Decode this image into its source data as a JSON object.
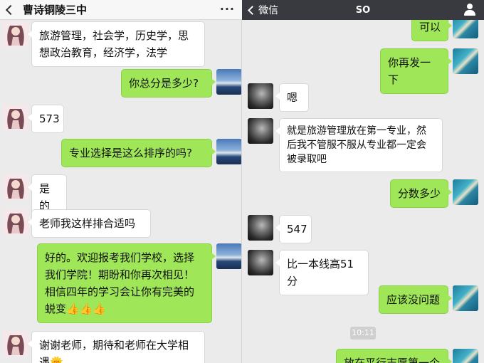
{
  "left_chat": {
    "title": "曹诗铜陵三中",
    "more_label": "···",
    "messages": [
      {
        "side": "in",
        "text": "旅游管理，社会学，历史学，思想政治教育，经济学，法学"
      },
      {
        "side": "out",
        "text": "你总分是多少?"
      },
      {
        "side": "in",
        "text": "573"
      },
      {
        "side": "out",
        "text": "专业选择是这么排序的吗?"
      },
      {
        "side": "in",
        "text": "是的"
      },
      {
        "side": "in",
        "text": "老师我这样排合适吗"
      },
      {
        "side": "out",
        "text": "好的。欢迎报考我们学校，选择我们学院！期盼和你再次相见！相信四年的学习会让你有完美的蜕变👍👍👍"
      },
      {
        "side": "in",
        "text": "谢谢老师，期待和老师在大学相遇🌞"
      }
    ]
  },
  "right_chat": {
    "back_label": "微信",
    "title": "SO",
    "time_badge": "10:11",
    "messages": [
      {
        "side": "out",
        "text": "可以"
      },
      {
        "side": "out",
        "text": "你再发一下"
      },
      {
        "side": "in",
        "text": "嗯"
      },
      {
        "side": "in",
        "text": "就是旅游管理放在第一专业，然后我不管服不服从专业都一定会被录取吧"
      },
      {
        "side": "out",
        "text": "分数多少"
      },
      {
        "side": "in",
        "text": "547"
      },
      {
        "side": "in",
        "text": "比一本线高51分"
      },
      {
        "side": "out",
        "text": "应该没问题"
      },
      {
        "side": "out",
        "text": "放在平行志愿第一个"
      }
    ]
  },
  "colors": {
    "outgoing_bubble": "#9fe658",
    "incoming_bubble": "#ffffff",
    "chat_background": "#ebebeb",
    "right_header": "#393a3f"
  },
  "icons": [
    "back-chevron-icon",
    "more-icon",
    "person-icon"
  ]
}
